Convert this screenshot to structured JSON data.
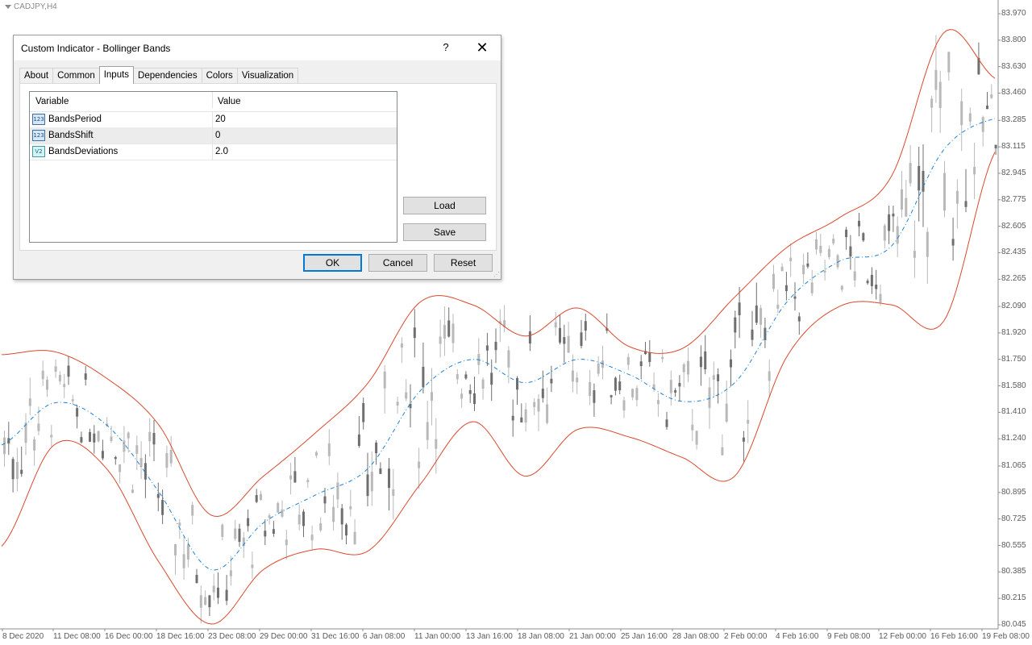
{
  "chart": {
    "symbol_label": "CADJPY,H4",
    "price_labels": [
      "83.970",
      "83.800",
      "83.630",
      "83.460",
      "83.285",
      "83.115",
      "82.945",
      "82.775",
      "82.605",
      "82.435",
      "82.265",
      "82.090",
      "81.920",
      "81.750",
      "81.580",
      "81.410",
      "81.240",
      "81.065",
      "80.895",
      "80.725",
      "80.555",
      "80.385",
      "80.215",
      "80.045"
    ],
    "time_labels": [
      "8 Dec 2020",
      "11 Dec 08:00",
      "16 Dec 00:00",
      "18 Dec 16:00",
      "23 Dec 08:00",
      "29 Dec 00:00",
      "31 Dec 16:00",
      "6 Jan 08:00",
      "11 Jan 00:00",
      "13 Jan 16:00",
      "18 Jan 08:00",
      "21 Jan 00:00",
      "25 Jan 16:00",
      "28 Jan 08:00",
      "2 Feb 00:00",
      "4 Feb 16:00",
      "9 Feb 08:00",
      "12 Feb 00:00",
      "16 Feb 16:00",
      "19 Feb 08:00"
    ],
    "colors": {
      "upper_band": "#d9492e",
      "lower_band": "#d9492e",
      "middle_line": "#1f82d6",
      "candles": "#a9a9a9"
    }
  },
  "chart_data": {
    "type": "line",
    "title": "CADJPY,H4",
    "y_range": [
      80.045,
      83.97
    ],
    "x": [
      "8 Dec 2020",
      "11 Dec 08:00",
      "16 Dec 00:00",
      "18 Dec 16:00",
      "23 Dec 08:00",
      "29 Dec 00:00",
      "31 Dec 16:00",
      "6 Jan 08:00",
      "11 Jan 00:00",
      "13 Jan 16:00",
      "18 Jan 08:00",
      "21 Jan 00:00",
      "25 Jan 16:00",
      "28 Jan 08:00",
      "2 Feb 00:00",
      "4 Feb 16:00",
      "9 Feb 08:00",
      "12 Feb 00:00",
      "16 Feb 16:00",
      "19 Feb 08:00"
    ],
    "series": [
      {
        "name": "Upper band",
        "values": [
          81.78,
          81.8,
          81.63,
          81.33,
          80.75,
          81.0,
          81.28,
          81.6,
          82.12,
          82.1,
          81.9,
          82.08,
          81.83,
          81.82,
          82.15,
          82.47,
          82.66,
          82.93,
          83.85,
          83.55
        ]
      },
      {
        "name": "Middle band",
        "values": [
          81.2,
          81.47,
          81.33,
          80.9,
          80.4,
          80.7,
          80.88,
          81.05,
          81.55,
          81.75,
          81.6,
          81.75,
          81.65,
          81.48,
          81.6,
          82.12,
          82.38,
          82.48,
          83.1,
          83.3
        ]
      },
      {
        "name": "Lower band",
        "values": [
          80.55,
          81.2,
          81.05,
          80.45,
          80.05,
          80.4,
          80.53,
          80.52,
          80.95,
          81.35,
          81.0,
          81.3,
          81.25,
          81.12,
          81.0,
          81.77,
          82.09,
          82.1,
          82.0,
          83.1
        ]
      }
    ]
  },
  "dialog": {
    "title": "Custom Indicator - Bollinger Bands",
    "help": "?",
    "close": "✕",
    "tabs": [
      "About",
      "Common",
      "Inputs",
      "Dependencies",
      "Colors",
      "Visualization"
    ],
    "active_tab": "Inputs",
    "grid": {
      "headers": [
        "Variable",
        "Value"
      ],
      "rows": [
        {
          "icon": "123",
          "name": "BandsPeriod",
          "value": "20"
        },
        {
          "icon": "123",
          "name": "BandsShift",
          "value": "0"
        },
        {
          "icon": "V2",
          "name": "BandsDeviations",
          "value": "2.0"
        }
      ]
    },
    "buttons": {
      "load": "Load",
      "save": "Save",
      "ok": "OK",
      "cancel": "Cancel",
      "reset": "Reset"
    }
  }
}
